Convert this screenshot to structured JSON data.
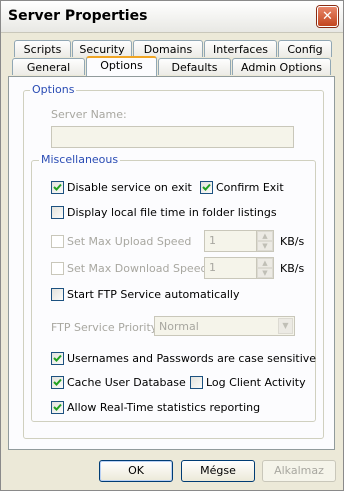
{
  "window": {
    "title": "Server Properties",
    "close_glyph": "✕"
  },
  "tabs": {
    "row1": [
      "Scripts",
      "Security",
      "Domains",
      "Interfaces",
      "Config"
    ],
    "row2": [
      "General",
      "Options",
      "Defaults",
      "Admin Options"
    ],
    "active": "Options"
  },
  "options_group": {
    "label": "Options",
    "server_name_label": "Server Name:",
    "server_name_value": ""
  },
  "misc_group": {
    "label": "Miscellaneous",
    "disable_service_on_exit": {
      "label": "Disable service on exit",
      "checked": true
    },
    "confirm_exit": {
      "label": "Confirm Exit",
      "checked": true
    },
    "display_local_file_time": {
      "label": "Display local file time in folder listings",
      "checked": false
    },
    "set_max_upload": {
      "label": "Set Max Upload Speed",
      "checked": false,
      "enabled": false,
      "value": "1",
      "unit": "KB/s"
    },
    "set_max_download": {
      "label": "Set Max Download Speed",
      "checked": false,
      "enabled": false,
      "value": "1",
      "unit": "KB/s"
    },
    "start_ftp_auto": {
      "label": "Start FTP Service automatically",
      "checked": false
    },
    "ftp_priority": {
      "label": "FTP Service Priority",
      "value": "Normal",
      "enabled": false
    },
    "case_sensitive": {
      "label": "Usernames and Passwords are case sensitive",
      "checked": true
    },
    "cache_user_db": {
      "label": "Cache User Database",
      "checked": true
    },
    "log_client_activity": {
      "label": "Log Client Activity",
      "checked": false
    },
    "realtime_stats": {
      "label": "Allow Real-Time statistics reporting",
      "checked": true
    }
  },
  "buttons": {
    "ok": "OK",
    "cancel": "Mégse",
    "apply": "Alkalmaz"
  }
}
